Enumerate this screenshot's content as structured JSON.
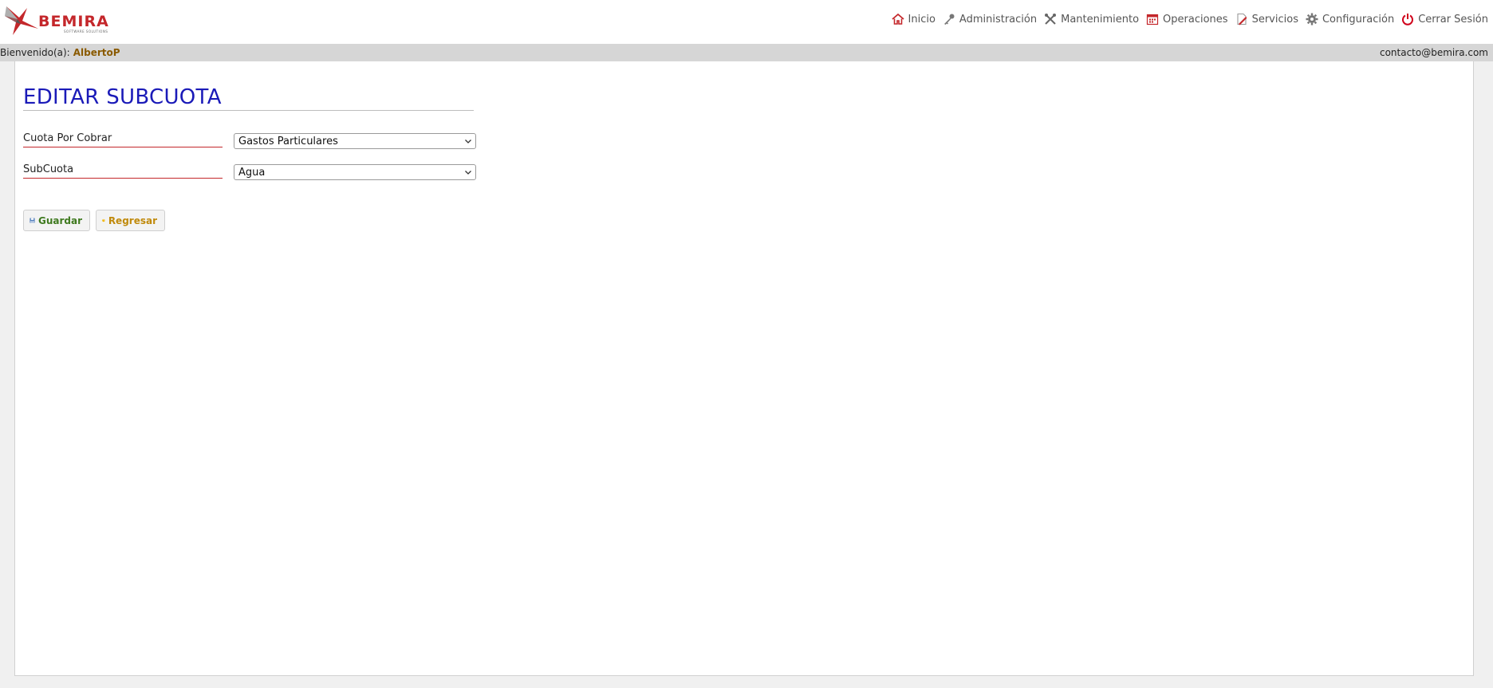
{
  "brand": {
    "name": "BEMIRA",
    "tagline": "SOFTWARE SOLUTIONS",
    "color": "#c4272b"
  },
  "nav": [
    {
      "label": "Inicio",
      "icon": "home-icon"
    },
    {
      "label": "Administración",
      "icon": "key-icon"
    },
    {
      "label": "Mantenimiento",
      "icon": "tools-icon"
    },
    {
      "label": "Operaciones",
      "icon": "calendar-icon"
    },
    {
      "label": "Servicios",
      "icon": "document-edit-icon"
    },
    {
      "label": "Configuración",
      "icon": "gear-icon"
    },
    {
      "label": "Cerrar Sesión",
      "icon": "power-icon"
    }
  ],
  "welcome": {
    "prefix": "Bienvenido(a):",
    "user": "AlbertoP",
    "contact": "contacto@bemira.com"
  },
  "page": {
    "title": "EDITAR SUBCUOTA"
  },
  "form": {
    "cuota": {
      "label": "Cuota Por Cobrar",
      "value": "Gastos Particulares"
    },
    "subcuota": {
      "label": "SubCuota",
      "value": "Agua"
    }
  },
  "buttons": {
    "save": "Guardar",
    "back": "Regresar"
  },
  "colors": {
    "title": "#1a1ab8",
    "label_underline": "#c4272b",
    "save_text": "#3f7a1f",
    "back_text": "#c08a0c"
  }
}
